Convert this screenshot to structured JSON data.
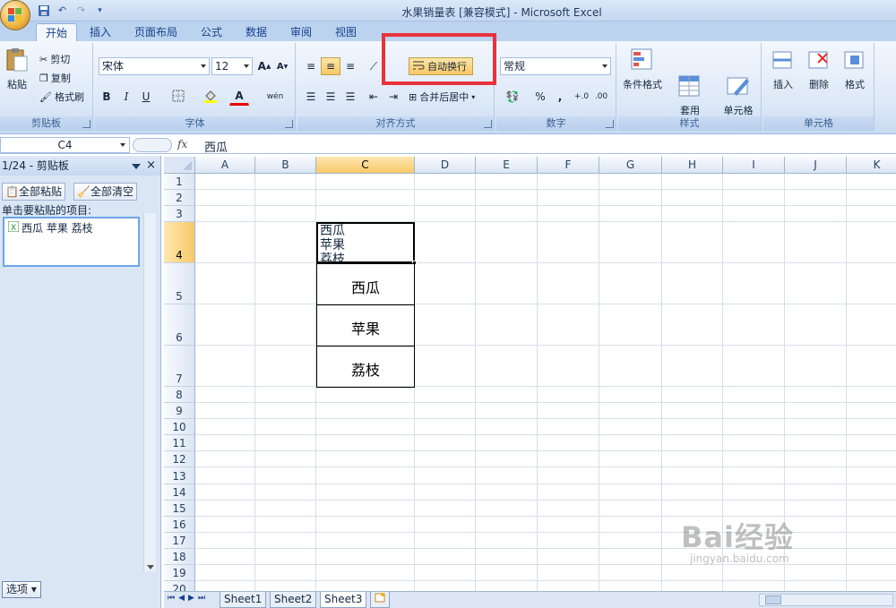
{
  "window": {
    "title": "水果销量表  [兼容模式] - Microsoft Excel"
  },
  "ribbon_tabs": [
    "开始",
    "插入",
    "页面布局",
    "公式",
    "数据",
    "审阅",
    "视图"
  ],
  "ribbon": {
    "clipboard": {
      "paste_label": "粘贴",
      "cut_label": "剪切",
      "copy_label": "复制",
      "format_painter_label": "格式刷",
      "group_label": "剪贴板"
    },
    "font": {
      "font_name": "宋体",
      "font_size": "12",
      "bold": "B",
      "italic": "I",
      "underline": "U",
      "grow": "A",
      "shrink": "A",
      "font_color": "A",
      "phonetic": "wén",
      "group_label": "字体"
    },
    "alignment": {
      "wrap_text_label": "自动换行",
      "merge_center_label": "合并后居中",
      "group_label": "对齐方式"
    },
    "number": {
      "format": "常规",
      "percent": "%",
      "comma": ",",
      "group_label": "数字"
    },
    "styles": {
      "conditional_label": "条件格式",
      "table_label": "套用\n表格格式",
      "cell_styles_label": "单元格\n样式",
      "group_label": "样式"
    },
    "cells": {
      "insert_label": "插入",
      "delete_label": "删除",
      "format_label": "格式",
      "group_label": "单元格"
    }
  },
  "formula_bar": {
    "name_box": "C4",
    "fx": "fx",
    "content": "西瓜"
  },
  "clipboard_pane": {
    "title": "1/24 - 剪贴板",
    "paste_all": "全部粘贴",
    "clear_all": "全部清空",
    "hint": "单击要粘贴的项目:",
    "items": [
      "西瓜 苹果 荔枝"
    ],
    "options": "选项"
  },
  "sheet": {
    "columns": [
      "A",
      "B",
      "C",
      "D",
      "E",
      "F",
      "G",
      "H",
      "I",
      "J",
      "K"
    ],
    "rows": [
      "1",
      "2",
      "3",
      "4",
      "5",
      "6",
      "7",
      "8",
      "9",
      "10",
      "11",
      "12",
      "13",
      "14",
      "15",
      "16",
      "17",
      "18",
      "19",
      "20"
    ],
    "selected_col": "C",
    "selected_row": "4",
    "c4_lines": [
      "西瓜",
      "苹果",
      "荔枝"
    ],
    "c5": "西瓜",
    "c6": "苹果",
    "c7": "荔枝"
  },
  "sheet_tabs": [
    "Sheet1",
    "Sheet2",
    "Sheet3"
  ],
  "active_sheet": "Sheet3",
  "watermark": {
    "line1": "Bai经验",
    "line2": "jingyan.baidu.com"
  },
  "colors": {
    "highlight": "#e8323c",
    "accent": "#f8c765"
  }
}
